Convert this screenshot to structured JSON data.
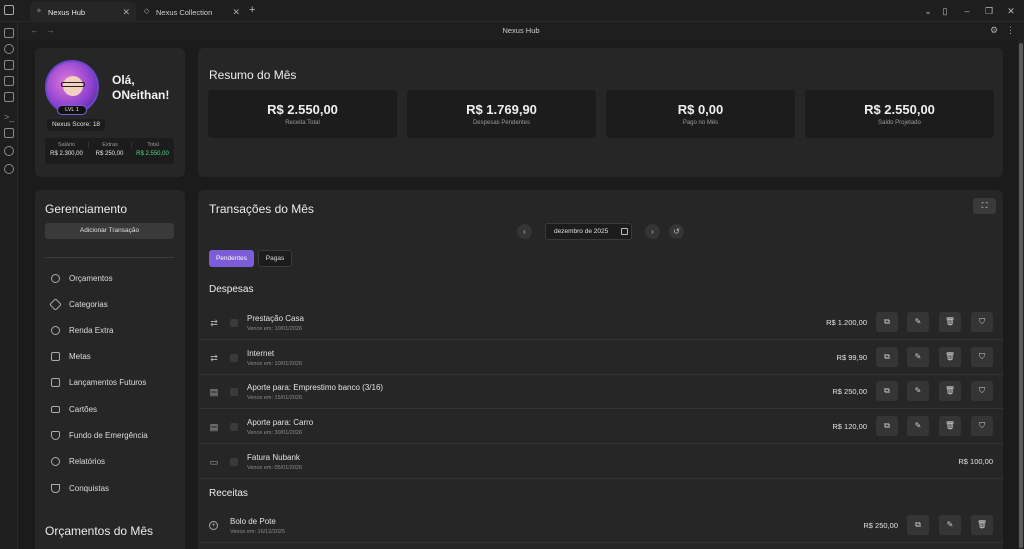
{
  "window": {
    "tabs": [
      {
        "label": "Nexus Hub",
        "active": true
      },
      {
        "label": "Nexus Collection",
        "active": false
      }
    ],
    "title": "Nexus Hub"
  },
  "profile": {
    "greeting": "Olá,",
    "name": "ONeithan!",
    "level": "LVL 1",
    "score": "Nexus Score: 18",
    "salary_label": "Salário",
    "salary": "R$ 2.300,00",
    "extras_label": "Extras",
    "extras": "R$ 250,00",
    "total_label": "Total",
    "total": "R$ 2.550,00"
  },
  "summary": {
    "title": "Resumo do Mês",
    "stats": [
      {
        "value": "R$ 2.550,00",
        "label": "Receita Total"
      },
      {
        "value": "R$ 1.769,90",
        "label": "Despesas Pendentes"
      },
      {
        "value": "R$ 0,00",
        "label": "Pago no Mês"
      },
      {
        "value": "R$ 2.550,00",
        "label": "Saldo Projetado"
      }
    ]
  },
  "management": {
    "title": "Gerenciamento",
    "add_button": "Adicionar Transação",
    "items": [
      {
        "label": "Orçamentos",
        "icon": "target-icon"
      },
      {
        "label": "Categorias",
        "icon": "tag-icon"
      },
      {
        "label": "Renda Extra",
        "icon": "plus-circle-icon"
      },
      {
        "label": "Metas",
        "icon": "flag-icon"
      },
      {
        "label": "Lançamentos Futuros",
        "icon": "calendar-icon"
      },
      {
        "label": "Cartões",
        "icon": "credit-card-icon"
      },
      {
        "label": "Fundo de Emergência",
        "icon": "shield-icon"
      },
      {
        "label": "Relatórios",
        "icon": "pie-chart-icon"
      },
      {
        "label": "Conquistas",
        "icon": "trophy-icon"
      }
    ],
    "budgets_title": "Orçamentos do Mês"
  },
  "transactions": {
    "title": "Transações do Mês",
    "month": "dezembro de 2025",
    "tabs": [
      {
        "label": "Pendentes",
        "active": true
      },
      {
        "label": "Pagas",
        "active": false
      }
    ],
    "expenses_title": "Despesas",
    "expenses": [
      {
        "name": "Prestação Casa",
        "due": "Vence em: 10/01/2026",
        "amount": "R$ 1.200,00",
        "icon": "repeat-icon"
      },
      {
        "name": "Internet",
        "due": "Vence em: 10/01/2026",
        "amount": "R$ 99,90",
        "icon": "repeat-icon"
      },
      {
        "name": "Aporte para: Emprestimo banco (3/16)",
        "due": "Vence em: 15/01/2026",
        "amount": "R$ 250,00",
        "icon": "document-icon"
      },
      {
        "name": "Aporte para: Carro",
        "due": "Vence em: 30/01/2026",
        "amount": "R$ 120,00",
        "icon": "document-icon"
      },
      {
        "name": "Fatura Nubank",
        "due": "Vence em: 05/01/2026",
        "amount": "R$ 100,00",
        "icon": "credit-card-icon"
      }
    ],
    "income_title": "Receitas",
    "income": [
      {
        "name": "Bolo de Pote",
        "due": "Vence em: 16/12/2025",
        "amount": "R$ 250,00",
        "icon": "plus-circle-icon"
      }
    ]
  },
  "colors": {
    "accent": "#7c5cd8",
    "positive": "#4ade80",
    "background": "#1b1b1b",
    "card": "#262626"
  }
}
